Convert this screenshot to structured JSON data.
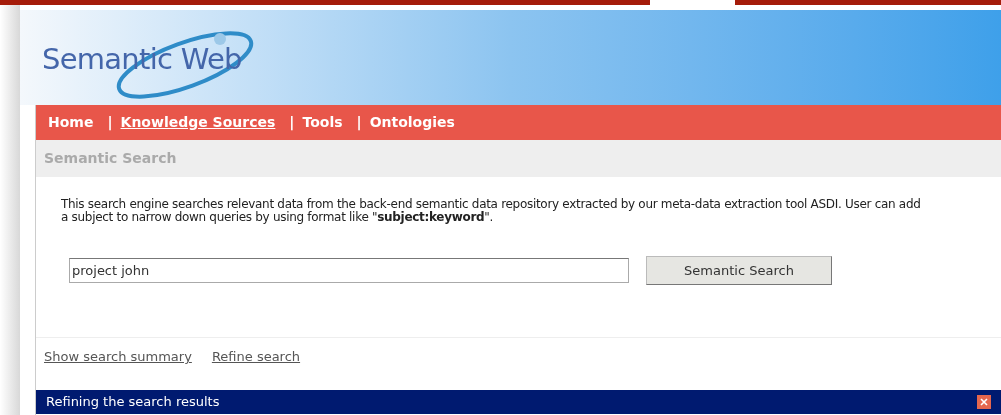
{
  "header": {
    "logo_text": "Semantic Web"
  },
  "nav": {
    "items": [
      {
        "kind": "link",
        "label": "Home",
        "selected": false
      },
      {
        "kind": "separator",
        "label": "|"
      },
      {
        "kind": "link",
        "label": "Knowledge Sources",
        "selected": true
      },
      {
        "kind": "separator",
        "label": "|"
      },
      {
        "kind": "link",
        "label": "Tools",
        "selected": false
      },
      {
        "kind": "separator",
        "label": "|"
      },
      {
        "kind": "link",
        "label": "Ontologies",
        "selected": false
      }
    ]
  },
  "section_title": "Semantic Search",
  "description": "This search engine searches relevant data from the back-end semantic data repository extracted by our meta-data extraction tool ASDI. User can add a subject to narrow down queries by using format like \"**subject:keyword**\".",
  "search": {
    "value": "project john",
    "button": "Semantic Search"
  },
  "links": [
    "Show search summary",
    "Refine search"
  ],
  "panel": {
    "title": "Refining the search results"
  }
}
